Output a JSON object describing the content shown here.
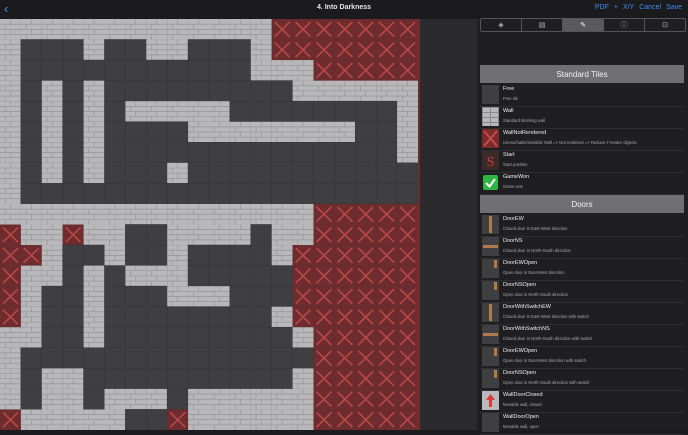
{
  "nav": {
    "back": "‹",
    "title": "4. Into Darkness",
    "pdf": "PDF",
    "grid": "+",
    "xy": "X/Y",
    "cancel": "Cancel",
    "save": "Save"
  },
  "toolbar": {
    "tabs": [
      {
        "icon": "layers-icon",
        "glyph": "◈"
      },
      {
        "icon": "calendar-icon",
        "glyph": "▤"
      },
      {
        "icon": "pencil-icon",
        "glyph": "✎",
        "active": true
      },
      {
        "icon": "info-icon",
        "glyph": "ⓘ"
      },
      {
        "icon": "gamepad-icon",
        "glyph": "⊡"
      }
    ]
  },
  "sections": {
    "standard": "Standard Tiles",
    "doors": "Doors"
  },
  "tiles_standard": [
    {
      "name": "Free",
      "desc": "Free tile",
      "icon": "plain"
    },
    {
      "name": "Wall",
      "desc": "Standard blocking wall",
      "icon": "wall"
    },
    {
      "name": "WallNotRendered",
      "desc": "Unreachable/invisible Wall => Not rendered => Reduce # render objects",
      "icon": "x"
    },
    {
      "name": "Start",
      "desc": "Start position",
      "icon": "start"
    },
    {
      "name": "GameWon",
      "desc": "Game won",
      "icon": "won"
    }
  ],
  "tiles_doors": [
    {
      "name": "DoorEW",
      "desc": "Closed door in East-West direction",
      "icon": "doorv"
    },
    {
      "name": "DoorNS",
      "desc": "Closed door in North-South direction",
      "icon": "doorh"
    },
    {
      "name": "DoorEWOpen",
      "desc": "Open door in East-West direction",
      "icon": "dooropen"
    },
    {
      "name": "DoorNSOpen",
      "desc": "Open door in North-South direction",
      "icon": "dooropen"
    },
    {
      "name": "DoorWithSwitchEW",
      "desc": "Closed door in East-West direction with switch",
      "icon": "doorv"
    },
    {
      "name": "DoorWithSwitchNS",
      "desc": "Closed door in North-South direction with switch",
      "icon": "doorh"
    },
    {
      "name": "DoorEWOpen",
      "desc": "Open door in East-West direction with switch",
      "icon": "dooropen"
    },
    {
      "name": "DoorNSOpen",
      "desc": "Open door in North-South direction with switch",
      "icon": "dooropen"
    },
    {
      "name": "WallDoorClosed",
      "desc": "Movable wall, closed",
      "icon": "wallarrow"
    },
    {
      "name": "WallDoorOpen",
      "desc": "Movable wall, open",
      "icon": "plain"
    }
  ],
  "map": {
    "rows": [
      "WWWWWWWWWWWWWXXXXXXXX",
      "WFFFWFFWWFFFWXXXXXXXX",
      "WFFFFFFFFFFFWWWXXXXXX",
      "WFWFWFFFFFFFFFWWWWWWX",
      "WFWFWFWWWWWFFFFFFFFWX",
      "WFWFWFFFFWWWWWWWWFFWX",
      "WFWFWFFFFFFFFFFFFFFWX",
      "WFWFWFFFWFFFFFFFFFFFX",
      "WFFFFFFFFFFFFFFFFFFFX",
      "WWWWWWWWWWWWWWWXXXXXX",
      "XWWXWWFFWWWWFWWXXXXXX",
      "XXWFFWFFWFFFFWXXXXXXX",
      "XWWFWFWWWFFFFFXXXXXXX",
      "XWFFWFFFWWWFFFXXXXXXX",
      "XWFFWFFFFFFFFWXXXXXXX",
      "WWFFWFFFFFFFFFWXXXXXX",
      "WFFFFFFFFFFFFFFXXXXXX",
      "WFWWFFFFFFFFFFWXXXXXX",
      "WFWWFWWWFWWWWWWXXXXXX",
      "XWWWWWFFXWWWWWWXXXXXX"
    ]
  }
}
